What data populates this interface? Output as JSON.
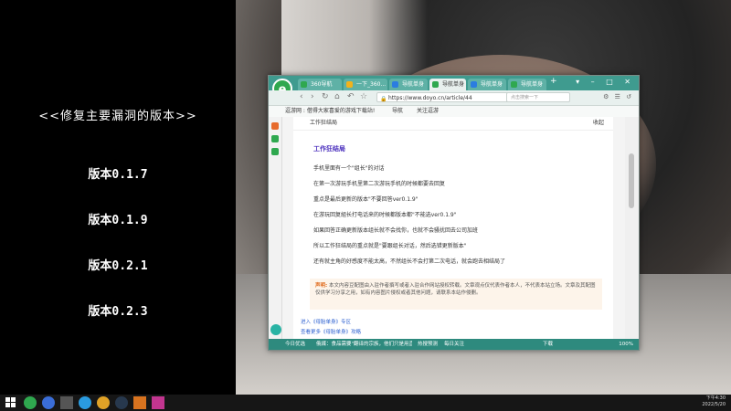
{
  "left_panel": {
    "title": "<<修复主要漏洞的版本>>",
    "versions": [
      "版本0.1.7",
      "版本0.1.9",
      "版本0.2.1",
      "版本0.2.3"
    ]
  },
  "browser": {
    "tabs": [
      {
        "label": "360导航",
        "active": false
      },
      {
        "label": "一下_360...",
        "active": false
      },
      {
        "label": "导航单身",
        "active": false
      },
      {
        "label": "导航单身",
        "active": true
      },
      {
        "label": "导航单身",
        "active": false
      },
      {
        "label": "导航单身",
        "active": false
      }
    ],
    "new_tab": "+",
    "url": "https://www.doyo.cn/article/44",
    "search_placeholder": "点击搜索一下",
    "bookmarks": {
      "site": "逗游网 : 借得大家喜爱的游戏下载站!",
      "nav": "导航",
      "follow": "关注逗游"
    },
    "article": {
      "breadcrumb": "工作狂结局",
      "collect": "收起",
      "heading": "工作狂结局",
      "paragraphs": [
        "手机里面有一个\"组长\"的对话",
        "在第一次游玩手机里第二次游玩手机的时候都要去回复",
        "重点是最后更新的版本\"不要回答ver0.1.9\"",
        "在游玩回复組长打电话来的时候都版本都\"不能选ver0.1.9\"",
        "如果回答正确更新版本组长就不会找你，也就不会骚扰回去公司加班",
        "所以工作狂结局的重点就是\"要跟组长对话，然后选错更新版本\"",
        "还有就主角的好感度不能太高，不然组长不会打第二次电话，就会跑去相结局了"
      ],
      "notice_label": "声明:",
      "notice_text": "本文内容豆配图由入驻作者撰写或者入驻合作网站授权转载。文章观点仅代表作者本人，不代表本站立场。文章及其配图仅供学习分享之用，如有内容图片侵权或者其他问题，请联系本站作侵删。",
      "links": [
        "进入《母胎单身》专区",
        "查看更多《母胎单身》攻略"
      ]
    },
    "status": {
      "left": "今日优选",
      "news": "俄媒：食品需要\"翻译的宗族，他们只是用直接数据...",
      "hot": "热搜预测",
      "follow": "每日关注",
      "download": "下载",
      "zoom": "100%"
    }
  },
  "taskbar": {
    "time": "下午4:30",
    "date": "2022/5/20"
  },
  "colors": {
    "browser_accent": "#3f9b8f",
    "heading": "#4a2fbd",
    "notice_label": "#e06a1b",
    "link": "#2b5fd0"
  }
}
